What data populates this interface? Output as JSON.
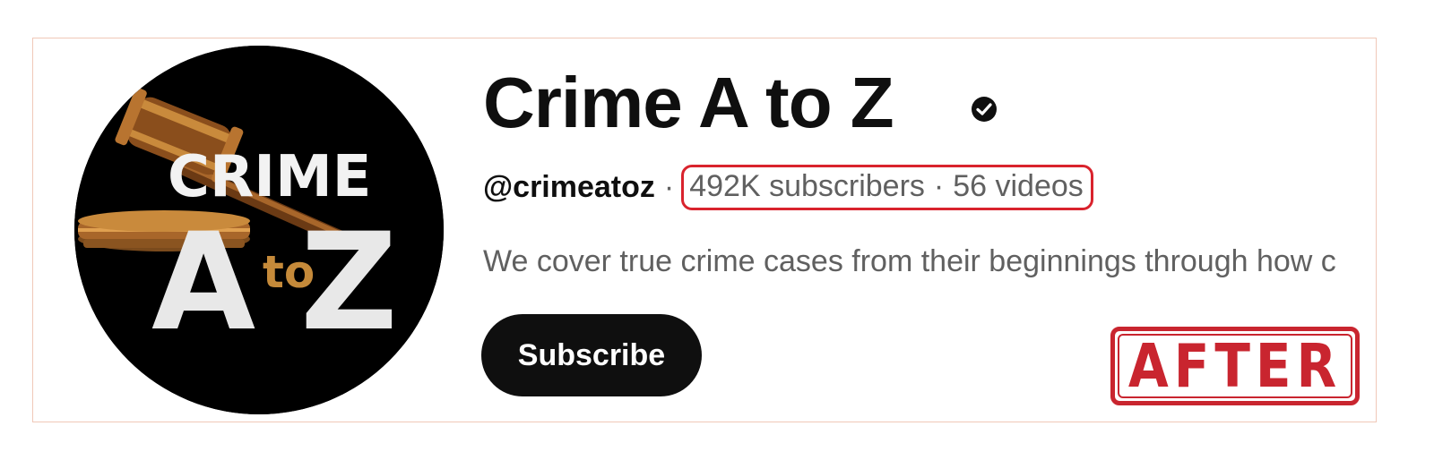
{
  "channel": {
    "name": "Crime A to Z",
    "verified_icon": "verified-check-icon",
    "handle": "@crimeatoz",
    "separator": "·",
    "subscribers": "492K subscribers",
    "inner_separator": "·",
    "videos": "56 videos",
    "description": "We cover true crime cases from their beginnings through how c",
    "subscribe_label": "Subscribe"
  },
  "avatar": {
    "logo_text_top": "CRIME",
    "logo_text_a": "A",
    "logo_text_to": "to",
    "logo_text_z": "Z",
    "icon": "gavel-icon"
  },
  "stamp": {
    "label": "AFTER"
  },
  "colors": {
    "highlight_border": "#d9232d",
    "stamp": "#c9252f",
    "button_bg": "#0f0f0f",
    "text_primary": "#0f0f0f",
    "text_secondary": "#606060"
  }
}
